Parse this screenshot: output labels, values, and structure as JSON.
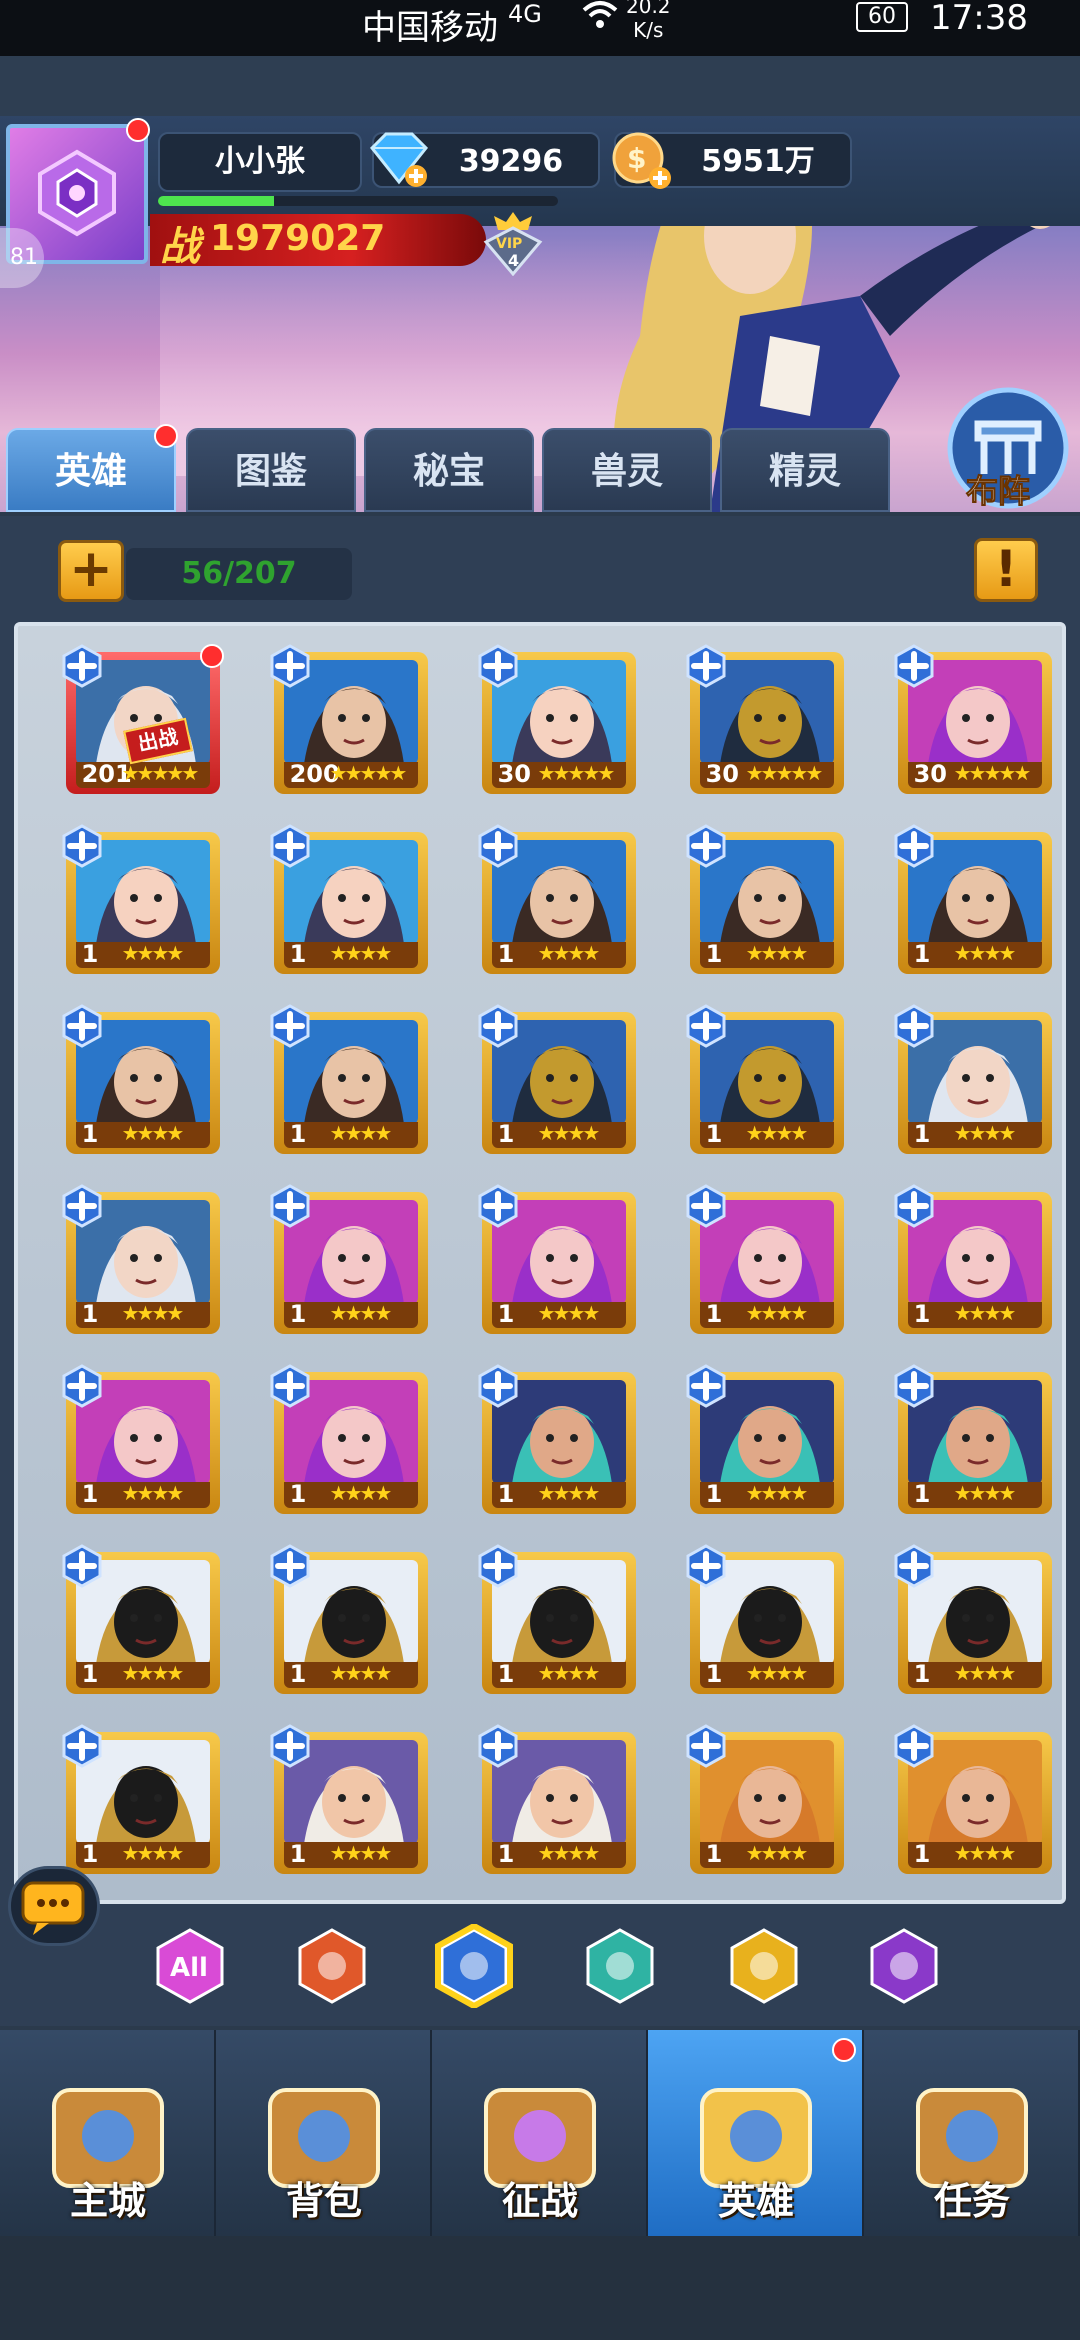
{
  "statusbar": {
    "carrier": "中国移动",
    "network": "4G",
    "speed_value": "20.2",
    "speed_unit": "K/s",
    "battery": "60",
    "time": "17:38"
  },
  "player": {
    "name": "小小张",
    "gems": "39296",
    "gold": "5951万",
    "power_char": "战",
    "power": "1979027",
    "vip_label": "VIP",
    "vip_level": "4",
    "side_level": "81",
    "xp_fraction": 0.29
  },
  "tabs": [
    {
      "label": "英雄",
      "active": true,
      "badge": true
    },
    {
      "label": "图鉴",
      "active": false
    },
    {
      "label": "秘宝",
      "active": false
    },
    {
      "label": "兽灵",
      "active": false
    },
    {
      "label": "精灵",
      "active": false
    }
  ],
  "formation_label": "布阵",
  "hero_count": "56/207",
  "info_symbol": "!",
  "add_symbol": "+",
  "deployed_tag": "出战",
  "heroes": [
    {
      "level": "201",
      "stars": 5,
      "portrait": "silver-hair",
      "deployed": true,
      "badge": true
    },
    {
      "level": "200",
      "stars": 5,
      "portrait": "dark-hair"
    },
    {
      "level": "30",
      "stars": 5,
      "portrait": "goggles-girl"
    },
    {
      "level": "30",
      "stars": 5,
      "portrait": "armored-knight"
    },
    {
      "level": "30",
      "stars": 5,
      "portrait": "purple-witch"
    },
    {
      "level": "1",
      "stars": 4,
      "portrait": "goggles-girl"
    },
    {
      "level": "1",
      "stars": 4,
      "portrait": "goggles-girl"
    },
    {
      "level": "1",
      "stars": 4,
      "portrait": "dark-hair"
    },
    {
      "level": "1",
      "stars": 4,
      "portrait": "dark-hair"
    },
    {
      "level": "1",
      "stars": 4,
      "portrait": "dark-hair"
    },
    {
      "level": "1",
      "stars": 4,
      "portrait": "dark-hair"
    },
    {
      "level": "1",
      "stars": 4,
      "portrait": "dark-hair"
    },
    {
      "level": "1",
      "stars": 4,
      "portrait": "armored-knight"
    },
    {
      "level": "1",
      "stars": 4,
      "portrait": "armored-knight"
    },
    {
      "level": "1",
      "stars": 4,
      "portrait": "silver-hair"
    },
    {
      "level": "1",
      "stars": 4,
      "portrait": "silver-hair"
    },
    {
      "level": "1",
      "stars": 4,
      "portrait": "purple-witch"
    },
    {
      "level": "1",
      "stars": 4,
      "portrait": "purple-witch"
    },
    {
      "level": "1",
      "stars": 4,
      "portrait": "purple-witch"
    },
    {
      "level": "1",
      "stars": 4,
      "portrait": "purple-witch"
    },
    {
      "level": "1",
      "stars": 4,
      "portrait": "purple-witch"
    },
    {
      "level": "1",
      "stars": 4,
      "portrait": "purple-witch"
    },
    {
      "level": "1",
      "stars": 4,
      "portrait": "old-engineer"
    },
    {
      "level": "1",
      "stars": 4,
      "portrait": "old-engineer"
    },
    {
      "level": "1",
      "stars": 4,
      "portrait": "old-engineer"
    },
    {
      "level": "1",
      "stars": 4,
      "portrait": "gold-helmet"
    },
    {
      "level": "1",
      "stars": 4,
      "portrait": "gold-helmet"
    },
    {
      "level": "1",
      "stars": 4,
      "portrait": "gold-helmet"
    },
    {
      "level": "1",
      "stars": 4,
      "portrait": "gold-helmet"
    },
    {
      "level": "1",
      "stars": 4,
      "portrait": "gold-helmet"
    },
    {
      "level": "1",
      "stars": 4,
      "portrait": "gold-helmet"
    },
    {
      "level": "1",
      "stars": 4,
      "portrait": "old-wizard"
    },
    {
      "level": "1",
      "stars": 4,
      "portrait": "old-wizard"
    },
    {
      "level": "1",
      "stars": 4,
      "portrait": "eyepatch-warrior"
    },
    {
      "level": "1",
      "stars": 4,
      "portrait": "eyepatch-warrior"
    }
  ],
  "filters": [
    {
      "name": "all",
      "label": "All",
      "color": "#d94bd6"
    },
    {
      "name": "fire",
      "label": "",
      "color": "#e0582a"
    },
    {
      "name": "cross",
      "label": "",
      "color": "#2f6fd8",
      "active": true
    },
    {
      "name": "skull",
      "label": "",
      "color": "#2fb3a3"
    },
    {
      "name": "wind",
      "label": "",
      "color": "#e8b11d"
    },
    {
      "name": "demon",
      "label": "",
      "color": "#8a39c9"
    }
  ],
  "nav": [
    {
      "label": "主城",
      "icon": "castle-icon"
    },
    {
      "label": "背包",
      "icon": "chest-icon"
    },
    {
      "label": "征战",
      "icon": "dragon-portal-icon"
    },
    {
      "label": "英雄",
      "icon": "golden-helmet-icon",
      "active": true,
      "badge": true
    },
    {
      "label": "任务",
      "icon": "scroll-icon"
    }
  ],
  "colors": {
    "accent_blue": "#3a7cc4",
    "gold": "#f7c94a",
    "power_red": "#d62020",
    "count_green": "#2fa32f"
  }
}
